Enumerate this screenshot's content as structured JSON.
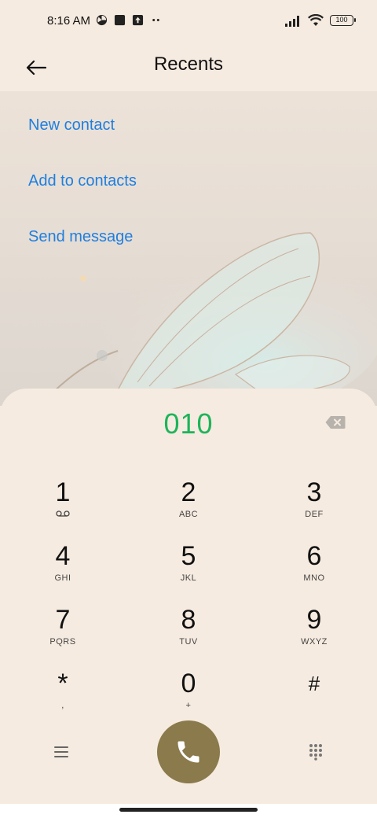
{
  "status_bar": {
    "time": "8:16 AM",
    "left_icons": [
      "chart-pie-icon",
      "square-app-icon",
      "upload-icon",
      "more-dots-icon"
    ],
    "right_icons": [
      "signal-icon",
      "wifi-icon",
      "battery-icon"
    ],
    "battery_level": "100"
  },
  "header": {
    "title": "Recents",
    "back_icon": "arrow-left-icon"
  },
  "actions": [
    {
      "label": "New contact"
    },
    {
      "label": "Add to contacts"
    },
    {
      "label": "Send message"
    }
  ],
  "dialer": {
    "number": "010",
    "keys": [
      {
        "digit": "1",
        "letters": ""
      },
      {
        "digit": "2",
        "letters": "ABC"
      },
      {
        "digit": "3",
        "letters": "DEF"
      },
      {
        "digit": "4",
        "letters": "GHI"
      },
      {
        "digit": "5",
        "letters": "JKL"
      },
      {
        "digit": "6",
        "letters": "MNO"
      },
      {
        "digit": "7",
        "letters": "PQRS"
      },
      {
        "digit": "8",
        "letters": "TUV"
      },
      {
        "digit": "9",
        "letters": "WXYZ"
      },
      {
        "digit": "*",
        "letters": ","
      },
      {
        "digit": "0",
        "letters": "+"
      },
      {
        "digit": "#",
        "letters": ""
      }
    ],
    "colors": {
      "number": "#1db45a",
      "call_button": "#8a7a4c",
      "link": "#1f7fe0",
      "background": "#f6ebe0"
    }
  }
}
